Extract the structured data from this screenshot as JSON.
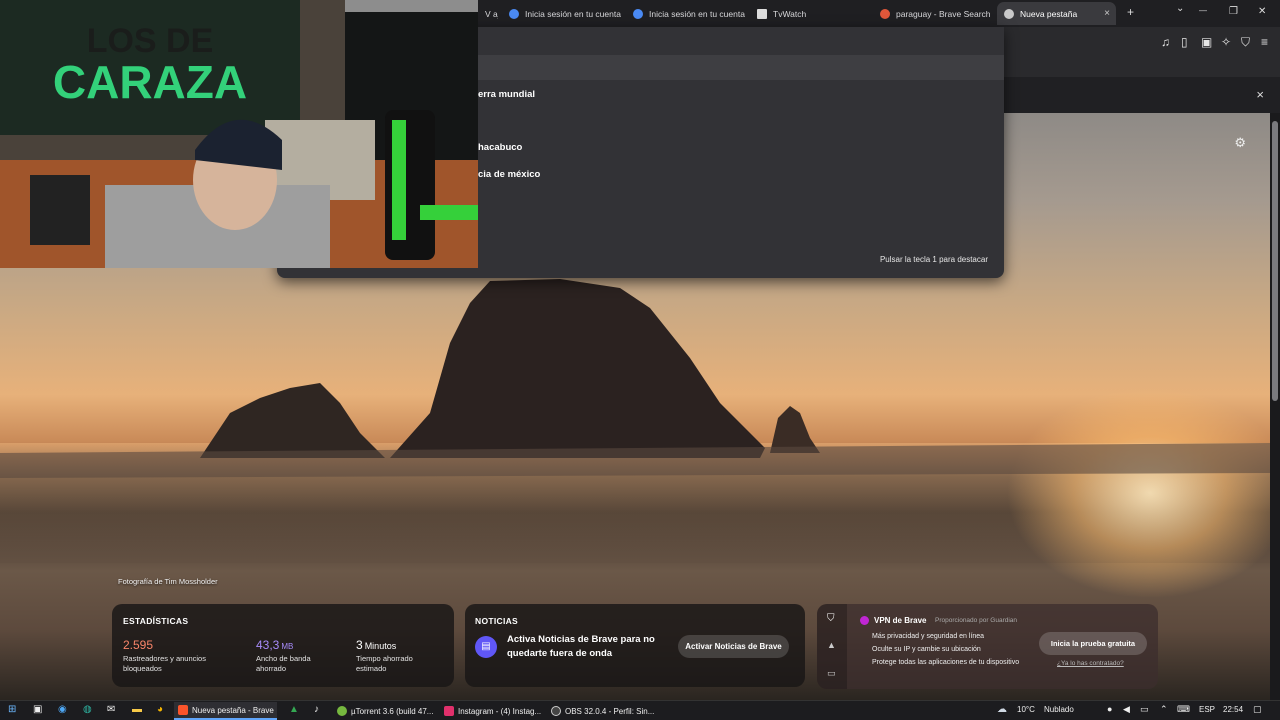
{
  "colors": {
    "stat_orange": "#f88469",
    "stat_purple": "#a78bfa",
    "stat_white": "#ffffff",
    "vpn_accent": "#c026d3",
    "news_accent": "#6057f6"
  },
  "tabs": [
    {
      "label": "V aj",
      "icon": "globe-icon"
    },
    {
      "label": "Inicia sesión en tu cuenta",
      "icon": "chrome-icon"
    },
    {
      "label": "Inicia sesión en tu cuenta",
      "icon": "chrome-icon"
    },
    {
      "label": "TvWatch",
      "icon": "tv-icon"
    },
    {
      "label": "paraguay - Brave Search",
      "icon": "brave-search-icon"
    },
    {
      "label": "Nueva pestaña",
      "icon": "brave-icon",
      "close": "×"
    }
  ],
  "window_controls": {
    "minimize": "—",
    "maximize": "❐",
    "close": "✕",
    "dropdown": "⌄"
  },
  "omnibox": {
    "suggestions": [
      "erra mundial",
      "hacabuco",
      "cia de méxico"
    ],
    "hint": "Pulsar la tecla 1 para destacar"
  },
  "infobar": {
    "close": "×"
  },
  "ntp": {
    "photo_credit": "Fotografía de Tim Mossholder",
    "stats": {
      "title": "ESTADÍSTICAS",
      "items": [
        {
          "value": "2.595",
          "unit": "",
          "desc": "Rastreadores y anuncios bloqueados"
        },
        {
          "value": "43,3",
          "unit": "MB",
          "desc": "Ancho de banda ahorrado"
        },
        {
          "value": "3",
          "unit": "Minutos",
          "desc": "Tiempo ahorrado estimado"
        }
      ]
    },
    "news": {
      "title": "NOTICIAS",
      "text": "Activa Noticias de Brave para no quedarte fuera de onda",
      "button": "Activar Noticias de Brave"
    },
    "vpn": {
      "title": "VPN de Brave",
      "provider": "Proporcionado por Guardian",
      "features": [
        "Más privacidad y seguridad en línea",
        "Oculte su IP y cambie su ubicación",
        "Protege todas las aplicaciones de tu dispositivo"
      ],
      "button": "Inicia la prueba gratuita",
      "link": "¿Ya lo has contratado?"
    }
  },
  "taskbar": {
    "apps": [
      {
        "label": "Nueva pestaña - Brave",
        "active": true
      },
      {
        "label": "µTorrent 3.6  (build 47...",
        "active": false
      },
      {
        "label": "Instagram - (4) Instag...",
        "active": false
      },
      {
        "label": "OBS 32.0.4 - Perfil: Sin...",
        "active": false
      }
    ],
    "weather": {
      "temp": "10°C",
      "condition": "Nublado"
    },
    "lang": "ESP",
    "time": "22:54"
  }
}
